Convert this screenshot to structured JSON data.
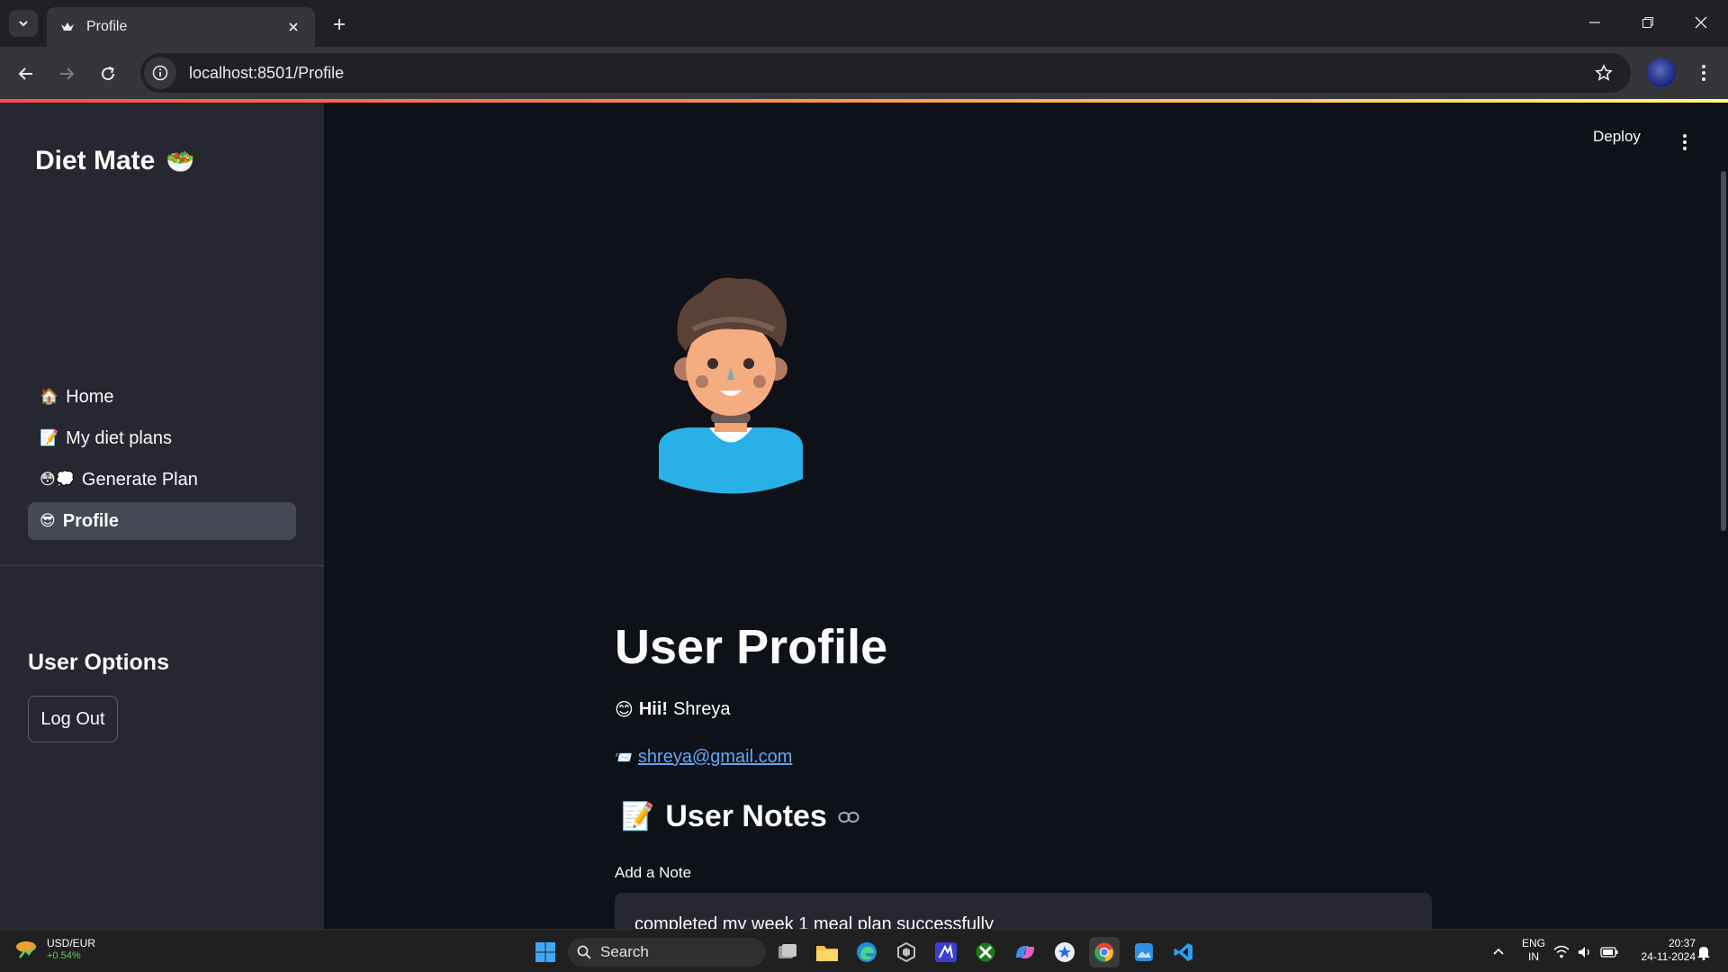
{
  "browser": {
    "tab_title": "Profile",
    "url": "localhost:8501/Profile"
  },
  "app": {
    "deploy_label": "Deploy"
  },
  "sidebar": {
    "brand": "Diet Mate",
    "brand_emoji": "🥗",
    "nav_items": [
      {
        "label": "Home",
        "emoji": "🏠",
        "active": false
      },
      {
        "label": "My diet plans",
        "emoji": "📝",
        "active": false
      },
      {
        "label": "Generate Plan",
        "emoji": "😳💭",
        "active": false
      },
      {
        "label": "Profile",
        "emoji": "😎",
        "active": true
      }
    ],
    "section_heading": "User Options",
    "logout_label": "Log Out"
  },
  "main": {
    "title": "User Profile",
    "greeting_emoji": "😊",
    "greeting_bold": "Hii!",
    "user_name": "Shreya",
    "email_emoji": "📨",
    "email": "shreya@gmail.com",
    "notes_emoji": "📝",
    "notes_heading": "User Notes",
    "note_input_label": "Add a Note",
    "note_value": "completed my week 1 meal plan successfully"
  },
  "taskbar": {
    "ticker": "USD/EUR",
    "ticker_change": "+0.54%",
    "search_label": "Search",
    "lang": "ENG",
    "region": "IN",
    "time": "20:37",
    "date": "24-11-2024"
  },
  "colors": {
    "app_bg": "#0e1117",
    "sidebar_bg": "#262730",
    "link": "#5fa8ff",
    "accent_gradient": [
      "#ff4b4b",
      "#fffd80"
    ]
  }
}
